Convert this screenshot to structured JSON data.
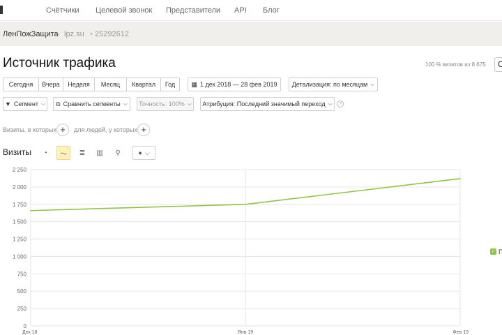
{
  "topnav": {
    "items": [
      "Счётчики",
      "Целевой звонок",
      "Представители",
      "API",
      "Блог"
    ]
  },
  "counter": {
    "name": "ЛенПожЗащита",
    "site": "lpz.su",
    "separator": "•",
    "id": "25292612"
  },
  "report": {
    "title": "Источник трафика",
    "sample_note": "100 % визитов из 8 675"
  },
  "period_buttons": [
    "Сегодня",
    "Вчера",
    "Неделя",
    "Месяц",
    "Квартал",
    "Год"
  ],
  "date_range": "1 дек 2018 — 28 фев 2019",
  "detail_select": "Детализация: по месяцам",
  "segment_button": "Сегмент",
  "compare_button": "Сравнить сегменты",
  "accuracy_button": "Точность: 100%",
  "attribution_select": "Атрибуция: Последний значимый переход",
  "conditions": {
    "visits_label": "Визиты, в которых",
    "people_label": "для людей, у которых",
    "plus": "+"
  },
  "chart_section": {
    "label": "Визиты"
  },
  "icons": {
    "pie": "pie-chart-icon",
    "line": "line-chart-icon",
    "stacked": "stacked-chart-icon",
    "bar": "bar-chart-icon",
    "map": "map-pin-icon",
    "comment": "comment-icon",
    "calendar": "calendar-icon",
    "dropdown": "chevron-down-icon",
    "help": "help-icon",
    "segment": "segment-icon",
    "compare": "compare-icon"
  },
  "colors": {
    "line": "#8cc63f",
    "grid": "#e6e6e6",
    "active_bg": "#fff2b8"
  },
  "legend": {
    "text": "П"
  },
  "chart_data": {
    "type": "line",
    "x": [
      "Дек 18",
      "Янв 19",
      "Фев 19"
    ],
    "series": [
      {
        "values": [
          1660,
          1750,
          2120
        ]
      }
    ],
    "y_ticks": [
      "0",
      "250",
      "500",
      "750",
      "1 000",
      "1 250",
      "1 500",
      "1 750",
      "2 000",
      "2 250"
    ],
    "ylim": [
      0,
      2250
    ],
    "grid": true
  }
}
